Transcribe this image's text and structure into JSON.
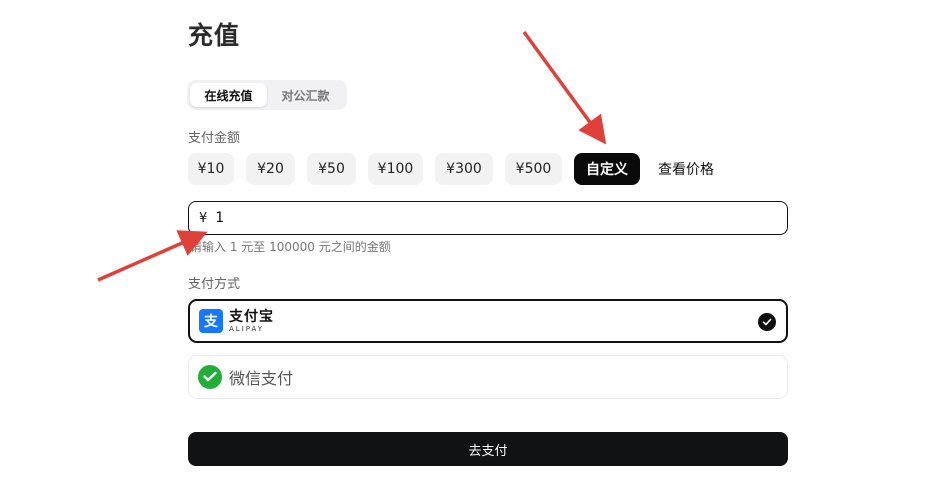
{
  "page": {
    "title": "充值"
  },
  "tabs": [
    {
      "label": "在线充值",
      "active": true
    },
    {
      "label": "对公汇款",
      "active": false
    }
  ],
  "amount_section": {
    "label": "支付金额",
    "options": [
      "¥10",
      "¥20",
      "¥50",
      "¥100",
      "¥300",
      "¥500",
      "自定义"
    ],
    "selected": "自定义",
    "view_price_link": "查看价格"
  },
  "custom_amount": {
    "currency": "¥",
    "value": "1",
    "hint": "请输入 1 元至 100000 元之间的金额"
  },
  "payment_method": {
    "label": "支付方式",
    "options": [
      {
        "name": "支付宝",
        "sub": "ALIPAY",
        "selected": true
      },
      {
        "name": "微信支付",
        "selected": false
      }
    ]
  },
  "submit": {
    "label": "去支付"
  },
  "colors": {
    "accent": "#111214",
    "alipay_blue": "#1677ff",
    "wechat_green": "#22ac38",
    "annotation_red": "#e0403a"
  }
}
